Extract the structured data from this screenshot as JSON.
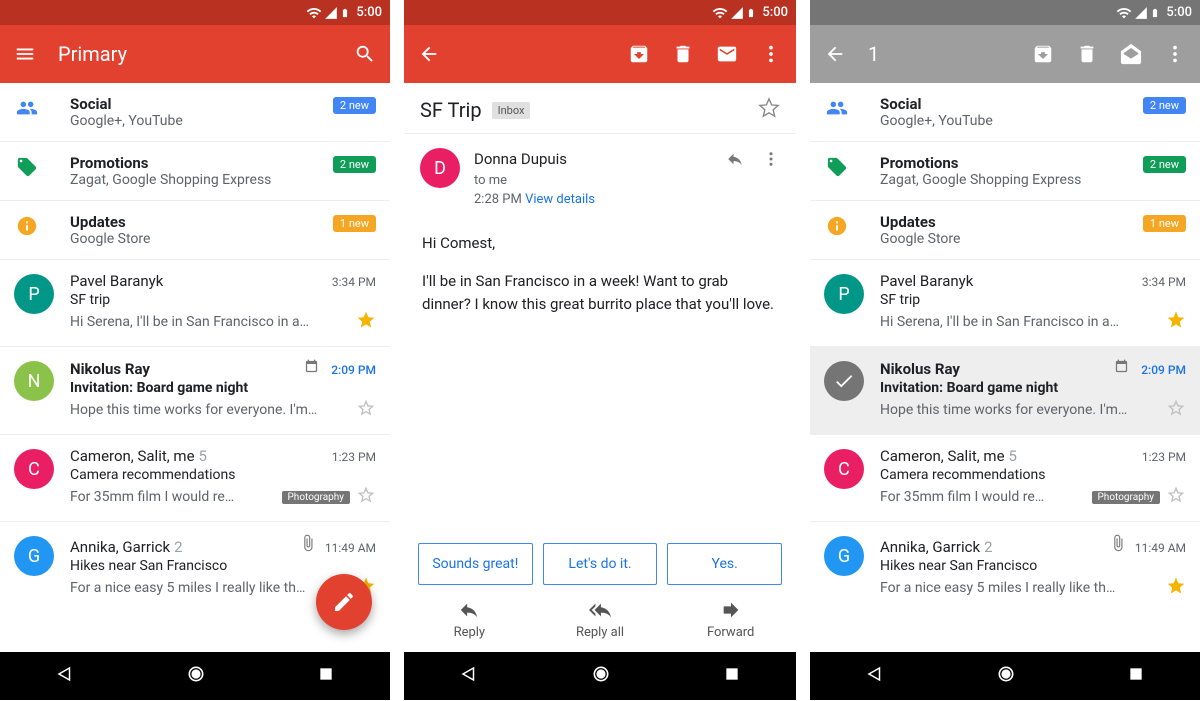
{
  "status": {
    "time": "5:00"
  },
  "inbox": {
    "title": "Primary",
    "categories": [
      {
        "name": "Social",
        "desc": "Google+, YouTube",
        "badge": "2 new",
        "badge_color": "blue",
        "icon": "people",
        "icon_color": "#4285f4"
      },
      {
        "name": "Promotions",
        "desc": "Zagat, Google Shopping Express",
        "badge": "2 new",
        "badge_color": "green",
        "icon": "tag",
        "icon_color": "#0f9d58"
      },
      {
        "name": "Updates",
        "desc": "Google Store",
        "badge": "1 new",
        "badge_color": "orange",
        "icon": "info",
        "icon_color": "#f5a623"
      }
    ],
    "threads": [
      {
        "sender": "Pavel Baranyk",
        "subject": "SF trip",
        "snippet": "Hi Serena, I'll be in San Francisco in a…",
        "time": "3:34 PM",
        "letter": "P",
        "color": "#009688",
        "starred": true,
        "bold": false,
        "calendar": false
      },
      {
        "sender": "Nikolus Ray",
        "subject": "Invitation: Board game night",
        "snippet": "Hope this time works for everyone. I'm…",
        "time": "2:09 PM",
        "letter": "N",
        "color": "#8bc34a",
        "starred": false,
        "bold": true,
        "calendar": true,
        "time_blue": true
      },
      {
        "sender": "Cameron, Salit, me",
        "count": "5",
        "subject": "Camera recommendations",
        "snippet": "For 35mm film I would re…",
        "chip": "Photography",
        "time": "1:23 PM",
        "letter": "C",
        "color": "#e91e63",
        "starred": false
      },
      {
        "sender": "Annika, Garrick",
        "count": "2",
        "subject": "Hikes near San Francisco",
        "snippet": "For a nice easy 5 miles I really like th…",
        "time": "11:49 AM",
        "letter": "G",
        "color": "#2196f3",
        "attach": true,
        "starred": true
      }
    ]
  },
  "reader": {
    "subject": "SF Trip",
    "label": "Inbox",
    "sender_name": "Donna Dupuis",
    "sender_letter": "D",
    "sender_to": "to me",
    "sender_time": "2:28 PM",
    "view_details": "View details",
    "body_greeting": "Hi Comest,",
    "body_para": "I'll be in San Francisco in a week! Want to grab dinner? I know this great burrito place that you'll love.",
    "smart": [
      "Sounds great!",
      "Let's do it.",
      "Yes."
    ],
    "actions": {
      "reply": "Reply",
      "reply_all": "Reply all",
      "forward": "Forward"
    }
  },
  "selection": {
    "count": "1",
    "selected_snippet": "Hope this time works for everyone. I'm…"
  }
}
